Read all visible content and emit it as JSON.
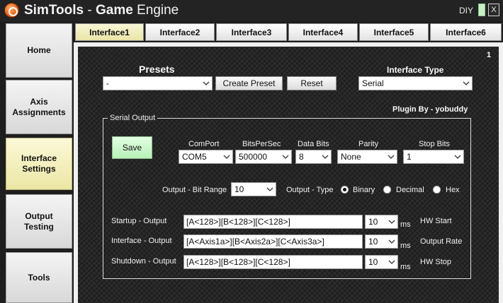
{
  "titlebar": {
    "app_name": "SimTools",
    "separator": " - ",
    "subtitle": "Game",
    "subtitle_rest": " Engine",
    "diy_label": "DIY",
    "close_label": "X"
  },
  "sidebar": {
    "items": [
      {
        "label": "Home",
        "active": false
      },
      {
        "label": "Axis Assignments",
        "active": false
      },
      {
        "label": "Interface Settings",
        "active": true
      },
      {
        "label": "Output Testing",
        "active": false
      },
      {
        "label": "Tools",
        "active": false
      }
    ]
  },
  "tabs": [
    {
      "label": "Interface1",
      "active": true
    },
    {
      "label": "Interface2",
      "active": false
    },
    {
      "label": "Interface3",
      "active": false
    },
    {
      "label": "Interface4",
      "active": false
    },
    {
      "label": "Interface5",
      "active": false
    },
    {
      "label": "Interface6",
      "active": false
    }
  ],
  "panel": {
    "page_number": "1",
    "presets_label": "Presets",
    "preset_value": "-",
    "create_preset_label": "Create Preset",
    "reset_label": "Reset",
    "interface_type_label": "Interface Type",
    "interface_type_value": "Serial",
    "plugin_by": "Plugin By - yobuddy"
  },
  "serial": {
    "group_title": "Serial Output",
    "save_label": "Save",
    "comport_label": "ComPort",
    "comport_value": "COM5",
    "bps_label": "BitsPerSec",
    "bps_value": "500000",
    "databits_label": "Data Bits",
    "databits_value": "8",
    "parity_label": "Parity",
    "parity_value": "None",
    "stopbits_label": "Stop Bits",
    "stopbits_value": "1",
    "bitrange_label": "Output - Bit Range",
    "bitrange_value": "10",
    "output_type_label": "Output - Type",
    "type_binary": "Binary",
    "type_decimal": "Decimal",
    "type_hex": "Hex",
    "selected_type": "Binary",
    "startup_label": "Startup - Output",
    "startup_value": "[A<128>][B<128>][C<128>]",
    "startup_ms": "10",
    "startup_unit": "ms",
    "startup_note": "HW Start",
    "interface_label": "Interface - Output",
    "interface_value": "[A<Axis1a>][B<Axis2a>][C<Axis3a>]",
    "interface_ms": "10",
    "interface_unit": "ms",
    "interface_note": "Output Rate",
    "shutdown_label": "Shutdown - Output",
    "shutdown_value": "[A<128>][B<128>][C<128>]",
    "shutdown_ms": "10",
    "shutdown_unit": "ms",
    "shutdown_note": "HW Stop"
  },
  "colors": {
    "active_tab": "#ebe4a8",
    "save_button": "#b8f0b8",
    "background": "#262626"
  }
}
